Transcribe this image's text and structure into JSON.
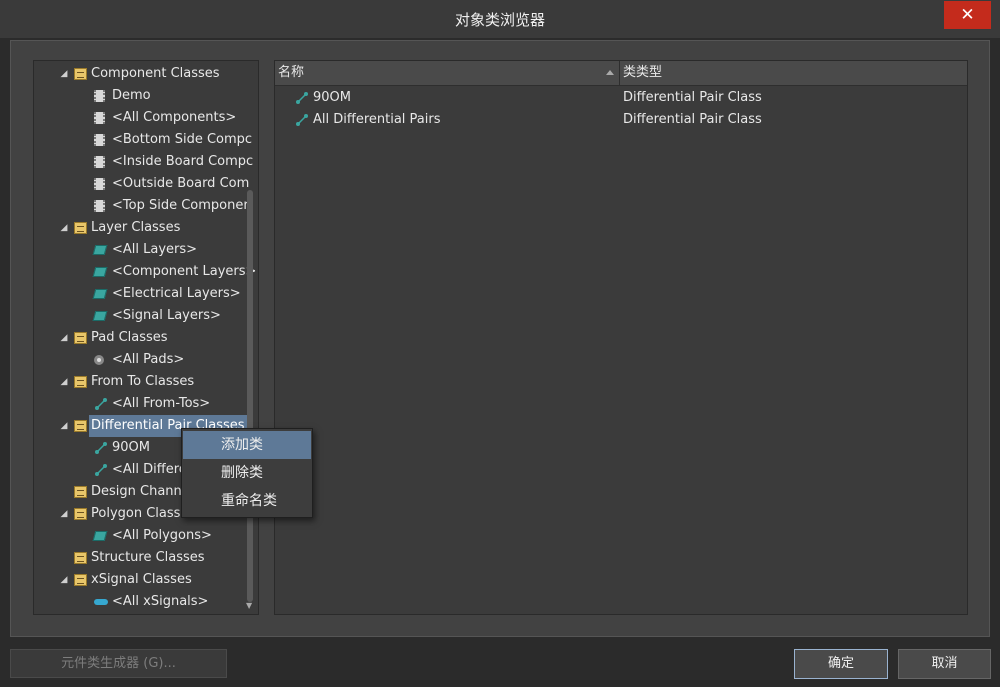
{
  "window": {
    "title": "对象类浏览器",
    "close_label": "✕"
  },
  "tree": {
    "items": [
      {
        "label": "Component Classes",
        "level": 0,
        "expanded": true,
        "icon": "folder-icon"
      },
      {
        "label": "Demo",
        "level": 1,
        "icon": "component-icon"
      },
      {
        "label": "<All Components>",
        "level": 1,
        "icon": "component-icon"
      },
      {
        "label": "<Bottom Side Compc",
        "level": 1,
        "icon": "component-icon"
      },
      {
        "label": "<Inside Board Compc",
        "level": 1,
        "icon": "component-icon"
      },
      {
        "label": "<Outside Board Com",
        "level": 1,
        "icon": "component-icon"
      },
      {
        "label": "<Top Side Componer",
        "level": 1,
        "icon": "component-icon"
      },
      {
        "label": "Layer Classes",
        "level": 0,
        "expanded": true,
        "icon": "folder-icon"
      },
      {
        "label": "<All Layers>",
        "level": 1,
        "icon": "layer-icon"
      },
      {
        "label": "<Component Layers>",
        "level": 1,
        "icon": "layer-icon"
      },
      {
        "label": "<Electrical Layers>",
        "level": 1,
        "icon": "layer-icon"
      },
      {
        "label": "<Signal Layers>",
        "level": 1,
        "icon": "layer-icon"
      },
      {
        "label": "Pad Classes",
        "level": 0,
        "expanded": true,
        "icon": "folder-icon"
      },
      {
        "label": "<All Pads>",
        "level": 1,
        "icon": "pad-icon"
      },
      {
        "label": "From To Classes",
        "level": 0,
        "expanded": true,
        "icon": "folder-icon"
      },
      {
        "label": "<All From-Tos>",
        "level": 1,
        "icon": "diff-pair-icon"
      },
      {
        "label": "Differential Pair Classes",
        "level": 0,
        "expanded": true,
        "icon": "folder-icon",
        "selected": true
      },
      {
        "label": "90OM",
        "level": 1,
        "icon": "diff-pair-icon"
      },
      {
        "label": "<All Differe",
        "level": 1,
        "icon": "diff-pair-icon"
      },
      {
        "label": "Design Channe",
        "level": 0,
        "expanded": false,
        "icon": "folder-icon"
      },
      {
        "label": "Polygon Classe",
        "level": 0,
        "expanded": true,
        "icon": "folder-icon"
      },
      {
        "label": "<All Polygons>",
        "level": 1,
        "icon": "layer-icon"
      },
      {
        "label": "Structure Classes",
        "level": 0,
        "expanded": false,
        "icon": "folder-icon"
      },
      {
        "label": "xSignal Classes",
        "level": 0,
        "expanded": true,
        "icon": "folder-icon"
      },
      {
        "label": "<All xSignals>",
        "level": 1,
        "icon": "xsignal-icon"
      }
    ]
  },
  "list": {
    "columns": [
      "名称",
      "类类型"
    ],
    "rows": [
      {
        "name": "90OM",
        "type": "Differential Pair Class"
      },
      {
        "name": "All Differential Pairs",
        "type": "Differential Pair Class"
      }
    ]
  },
  "context_menu": {
    "items": [
      {
        "label": "添加类",
        "highlighted": true
      },
      {
        "label": "删除类"
      },
      {
        "label": "重命名类"
      }
    ]
  },
  "buttons": {
    "generator": "元件类生成器 (G)...",
    "ok": "确定",
    "cancel": "取消"
  },
  "colors": {
    "selection": "#5e7997",
    "close": "#c42b1c",
    "accent_teal": "#3aa6a0"
  }
}
